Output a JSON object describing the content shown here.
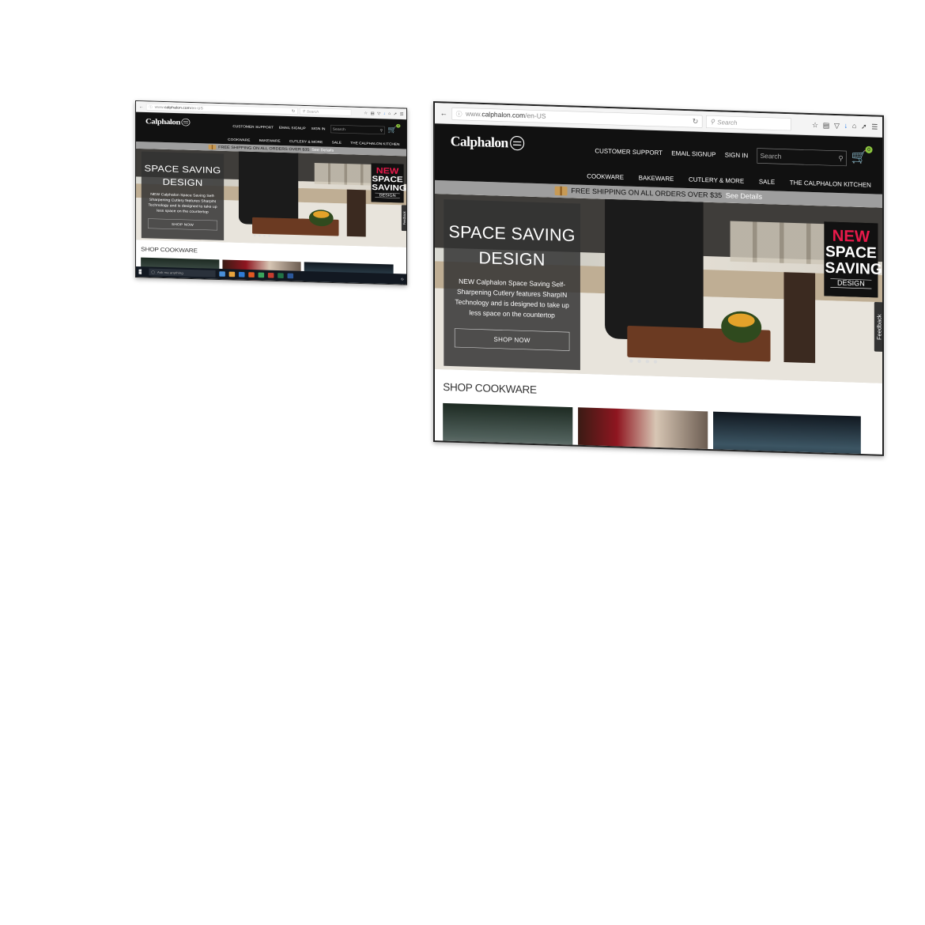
{
  "browser": {
    "url_prefix": "www.",
    "url_domain": "calphalon.com",
    "url_path": "/en-US",
    "search_placeholder": "Search",
    "icons": [
      "back-icon",
      "info-icon",
      "reload-icon",
      "search-icon",
      "star-icon",
      "reading-list-icon",
      "pocket-icon",
      "download-icon",
      "home-icon",
      "share-icon",
      "menu-icon"
    ]
  },
  "header": {
    "logo": "Calphalon",
    "utility_links": [
      "CUSTOMER SUPPORT",
      "EMAIL SIGNUP",
      "SIGN IN"
    ],
    "search_placeholder": "Search",
    "cart_count": "0",
    "nav": [
      "COOKWARE",
      "BAKEWARE",
      "CUTLERY & MORE",
      "SALE",
      "THE CALPHALON KITCHEN"
    ]
  },
  "promo": {
    "text": "FREE SHIPPING ON ALL ORDERS OVER $35",
    "link": "See Details"
  },
  "hero": {
    "title_line1": "SPACE SAVING",
    "title_line2": "DESIGN",
    "body": "NEW Calphalon Space Saving Self-Sharpening Cutlery features SharpIN Technology and is designed to take up less space on the countertop",
    "cta": "SHOP NOW",
    "badge_new": "NEW",
    "badge_line1": "SPACE",
    "badge_line2": "SAVING",
    "badge_line3": "DESIGN",
    "slides": 4
  },
  "feedback": "Feedback",
  "section": {
    "title": "SHOP COOKWARE"
  },
  "taskbar": {
    "search_placeholder": "Ask me anything"
  }
}
